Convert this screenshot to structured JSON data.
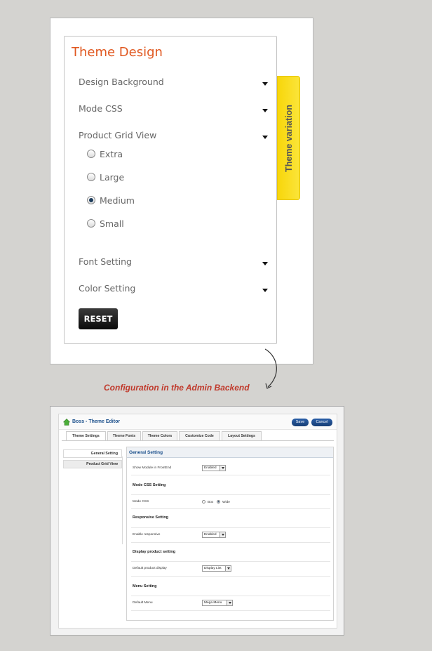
{
  "theme_panel": {
    "title": "Theme Design",
    "menu": [
      {
        "label": "Design Background"
      },
      {
        "label": "Mode CSS"
      },
      {
        "label": "Product Grid View"
      }
    ],
    "grid_options": [
      {
        "label": "Extra",
        "checked": false
      },
      {
        "label": "Large",
        "checked": false
      },
      {
        "label": "Medium",
        "checked": true
      },
      {
        "label": "Small",
        "checked": false
      }
    ],
    "menu_bottom": [
      {
        "label": "Font Setting"
      },
      {
        "label": "Color Setting"
      }
    ],
    "reset_label": "RESET",
    "side_tab_label": "Theme variation"
  },
  "caption": "Configuration in the Admin Backend",
  "admin": {
    "title": "Boss - Theme Editor",
    "save_label": "Save",
    "cancel_label": "Cancel",
    "tabs": [
      "Theme Settings",
      "Theme Fonts",
      "Theme Colors",
      "Customize Code",
      "Layout Settings"
    ],
    "active_tab": "Theme Settings",
    "sidebar": [
      "General Setting",
      "Product Grid View"
    ],
    "panel_title": "General Setting",
    "show_module_label": "Show Module in FrontEnd",
    "show_module_value": "Enabled",
    "mode_css_section": "Mode CSS Setting",
    "mode_css_label": "Mode CSS",
    "mode_css_options": [
      {
        "label": "Box",
        "checked": false
      },
      {
        "label": "Wide",
        "checked": true
      }
    ],
    "responsive_section": "Responsive Setting",
    "enable_responsive_label": "Enable responsive",
    "enable_responsive_value": "Enabled",
    "display_section": "Display product setting",
    "default_display_label": "Default product display",
    "default_display_value": "Display List",
    "menu_section": "Menu Setting",
    "default_menu_label": "Default Menu",
    "default_menu_value": "Mega Menu"
  },
  "colors": {
    "title_orange": "#e0571f",
    "tab_yellow": "#f8d60a",
    "caption_red": "#c0392b",
    "admin_blue": "#1a4f8b"
  }
}
